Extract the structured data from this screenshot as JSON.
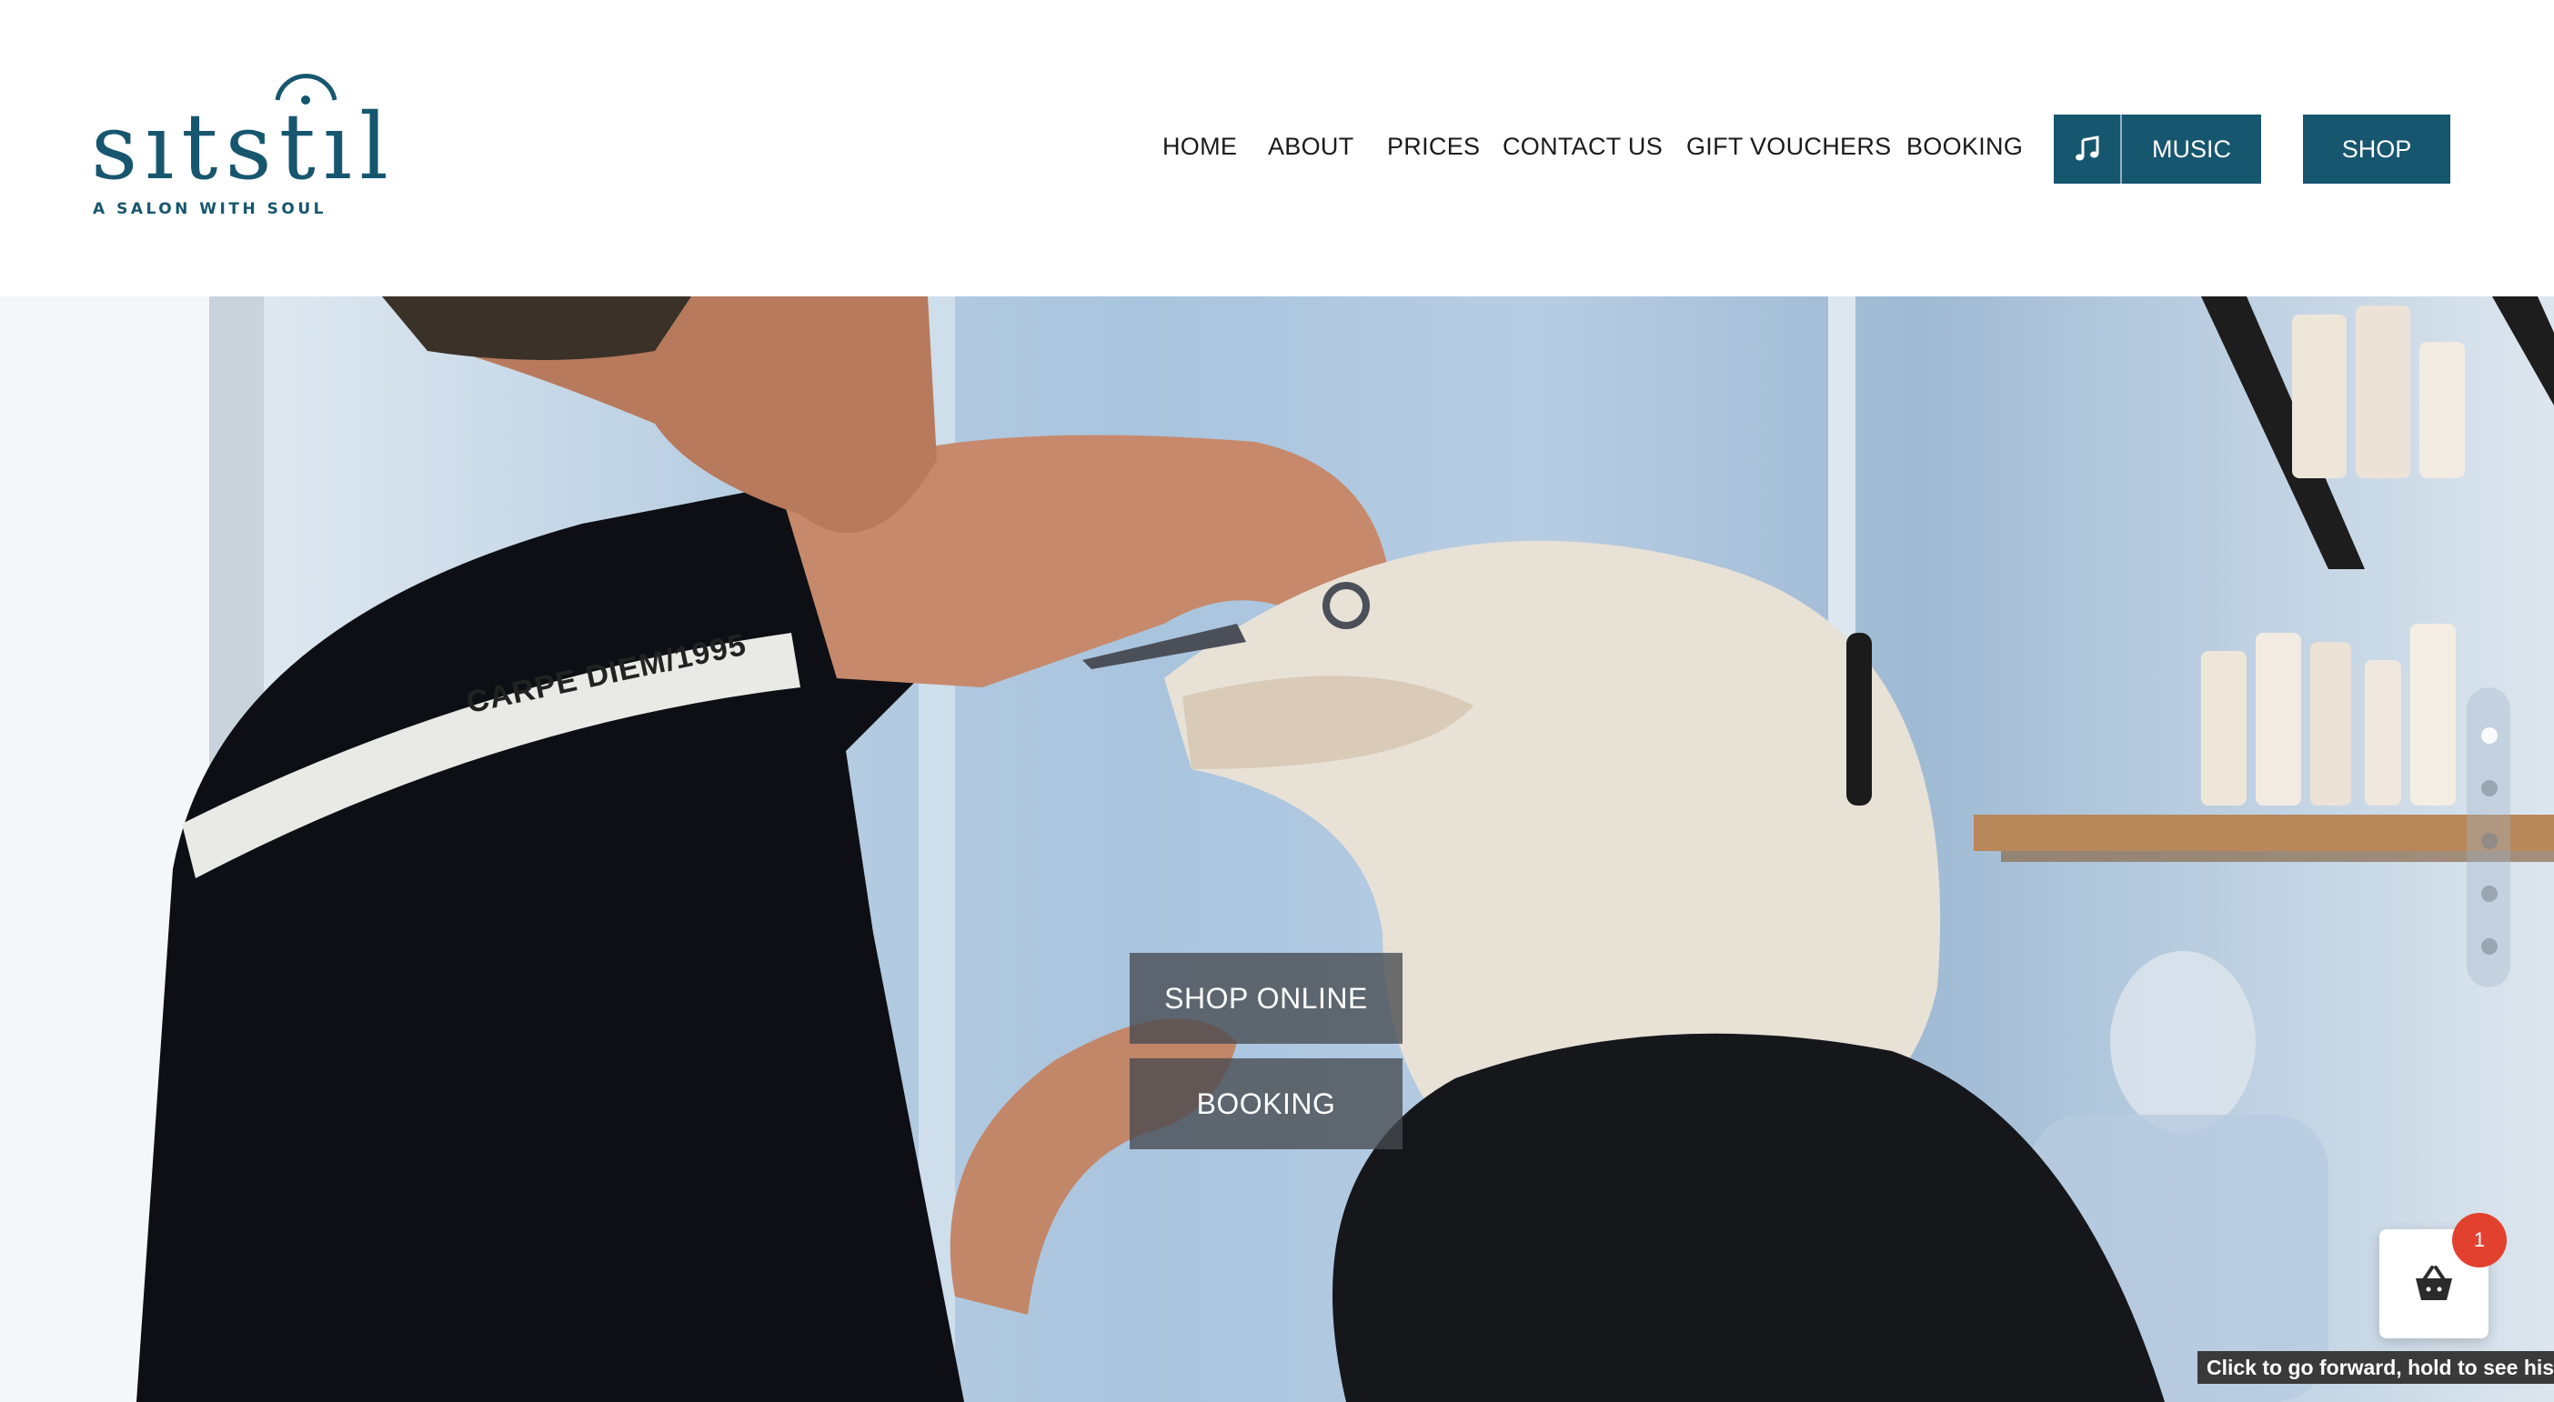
{
  "brand": {
    "wordmark": "sıtstıl",
    "tagline": "A SALON WITH SOUL",
    "color": "#17566f"
  },
  "nav": {
    "items": [
      {
        "label": "HOME"
      },
      {
        "label": "ABOUT"
      },
      {
        "label": "PRICES"
      },
      {
        "label": "CONTACT US"
      },
      {
        "label": "GIFT VOUCHERS"
      },
      {
        "label": "BOOKING"
      }
    ],
    "music": {
      "label": "MUSIC",
      "icon": "music-note-icon"
    },
    "shop": {
      "label": "SHOP"
    }
  },
  "hero": {
    "shirt_text": "CARPE DIEM/1995",
    "buttons": [
      {
        "label": "SHOP ONLINE"
      },
      {
        "label": "BOOKING"
      }
    ],
    "slider": {
      "count": 5,
      "active_index": 0
    }
  },
  "cart": {
    "count": "1",
    "icon": "basket-icon",
    "badge_color": "#e3412f"
  },
  "tooltip": {
    "text": "Click to go forward, hold to see histo"
  }
}
